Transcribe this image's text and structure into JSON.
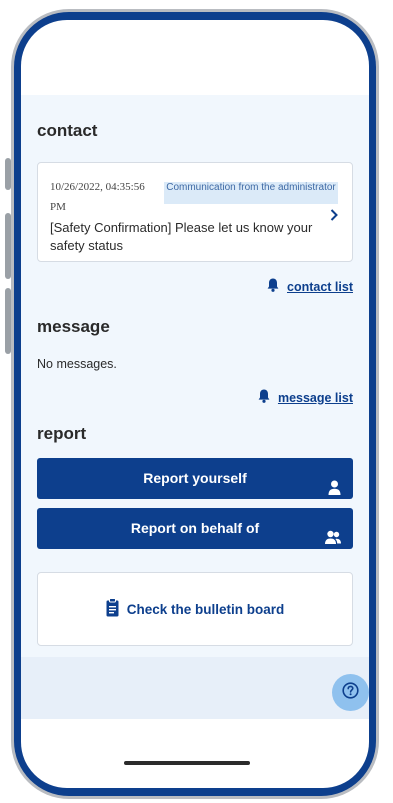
{
  "contact": {
    "title": "contact",
    "card": {
      "datetime": "10/26/2022, 04:35:56 PM",
      "badge": "Communication from the administrator",
      "message": "[Safety Confirmation] Please let us know your safety status"
    },
    "link_label": "contact list"
  },
  "message": {
    "title": "message",
    "empty_text": "No messages.",
    "link_label": "message list"
  },
  "report": {
    "title": "report",
    "report_yourself_label": "Report yourself",
    "report_behalf_label": "Report on behalf of"
  },
  "bulletin": {
    "label": "Check the bulletin board"
  },
  "colors": {
    "primary": "#0d3f8d",
    "background": "#f1f7fd",
    "badge_bg": "#dbeaf8",
    "help_bg": "#8fc1ee"
  },
  "icons": {
    "contact_link": "bell-icon",
    "message_link": "bell-icon",
    "report_yourself": "person-icon",
    "report_behalf": "people-icon",
    "bulletin": "clipboard-icon",
    "help": "question-icon",
    "card_arrow": "chevron-right-icon"
  }
}
